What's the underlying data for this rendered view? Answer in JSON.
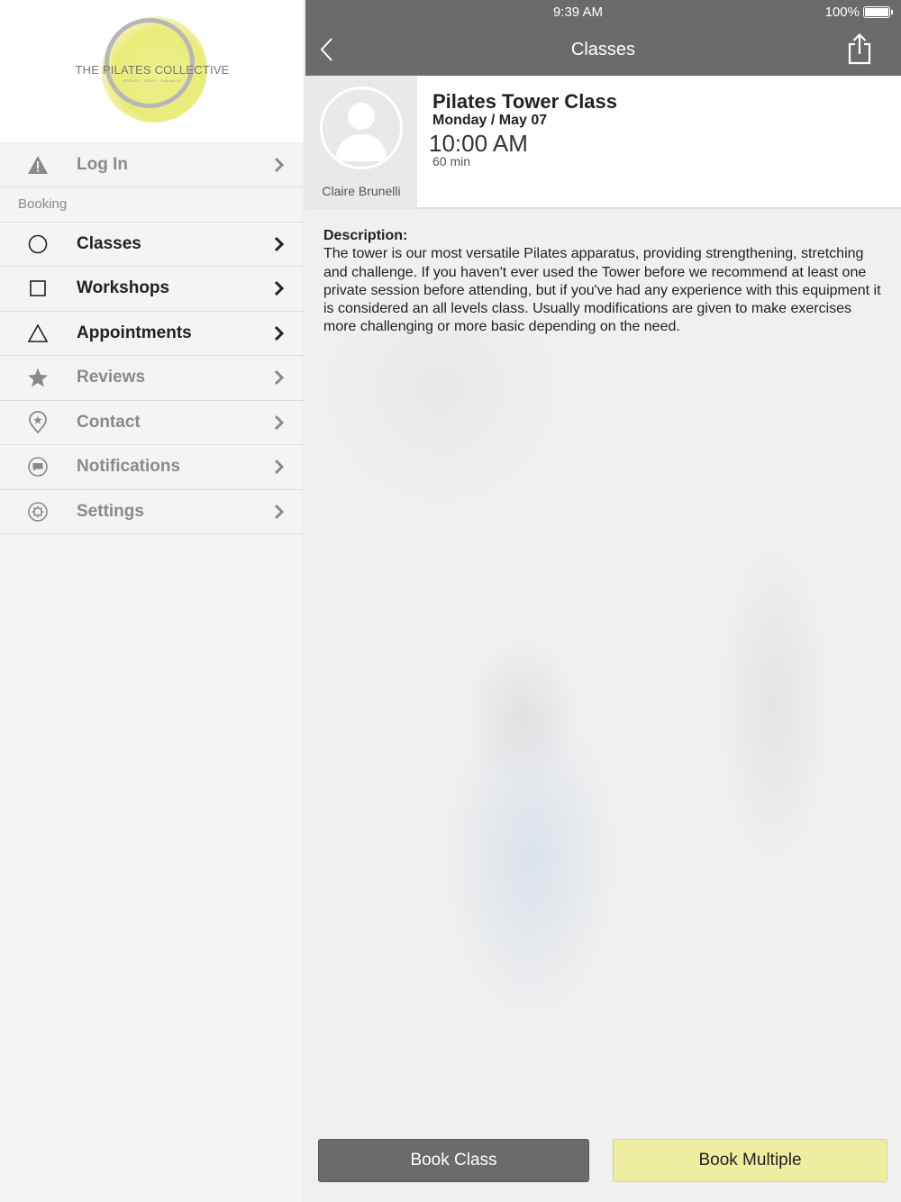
{
  "status_bar": {
    "time": "9:39 AM",
    "battery": "100%"
  },
  "logo": {
    "name": "THE PILATES COLLECTIVE",
    "tagline": "BREATH · BODY · BALANCE"
  },
  "sidebar": {
    "login": {
      "label": "Log In",
      "icon": "warning-icon"
    },
    "section_header": "Booking",
    "items": [
      {
        "label": "Classes",
        "icon": "circle-icon",
        "active": true
      },
      {
        "label": "Workshops",
        "icon": "square-icon",
        "active": true
      },
      {
        "label": "Appointments",
        "icon": "triangle-icon",
        "active": true
      },
      {
        "label": "Reviews",
        "icon": "star-icon",
        "active": false
      },
      {
        "label": "Contact",
        "icon": "location-pin-icon",
        "active": false
      },
      {
        "label": "Notifications",
        "icon": "chat-bubble-icon",
        "active": false
      },
      {
        "label": "Settings",
        "icon": "gear-icon",
        "active": false
      }
    ]
  },
  "nav": {
    "title": "Classes"
  },
  "class": {
    "title": "Pilates Tower Class",
    "date": "Monday / May 07",
    "time": "10:00 AM",
    "duration": "60 min",
    "instructor": "Claire Brunelli"
  },
  "description": {
    "label": "Description:",
    "text": "The tower is our most versatile Pilates apparatus, providing strengthening, stretching and challenge. If you haven't ever used the Tower before we recommend at least one private session before attending, but if you've had any experience with this equipment it is considered an all levels class. Usually modifications are given to make exercises more challenging or more basic depending on the need."
  },
  "buttons": {
    "book_class": "Book Class",
    "book_multiple": "Book Multiple"
  },
  "colors": {
    "bar": "#6b6b6b",
    "accent": "#eeeea0",
    "active_text": "#222222",
    "inactive_text": "#8a8a8a"
  }
}
